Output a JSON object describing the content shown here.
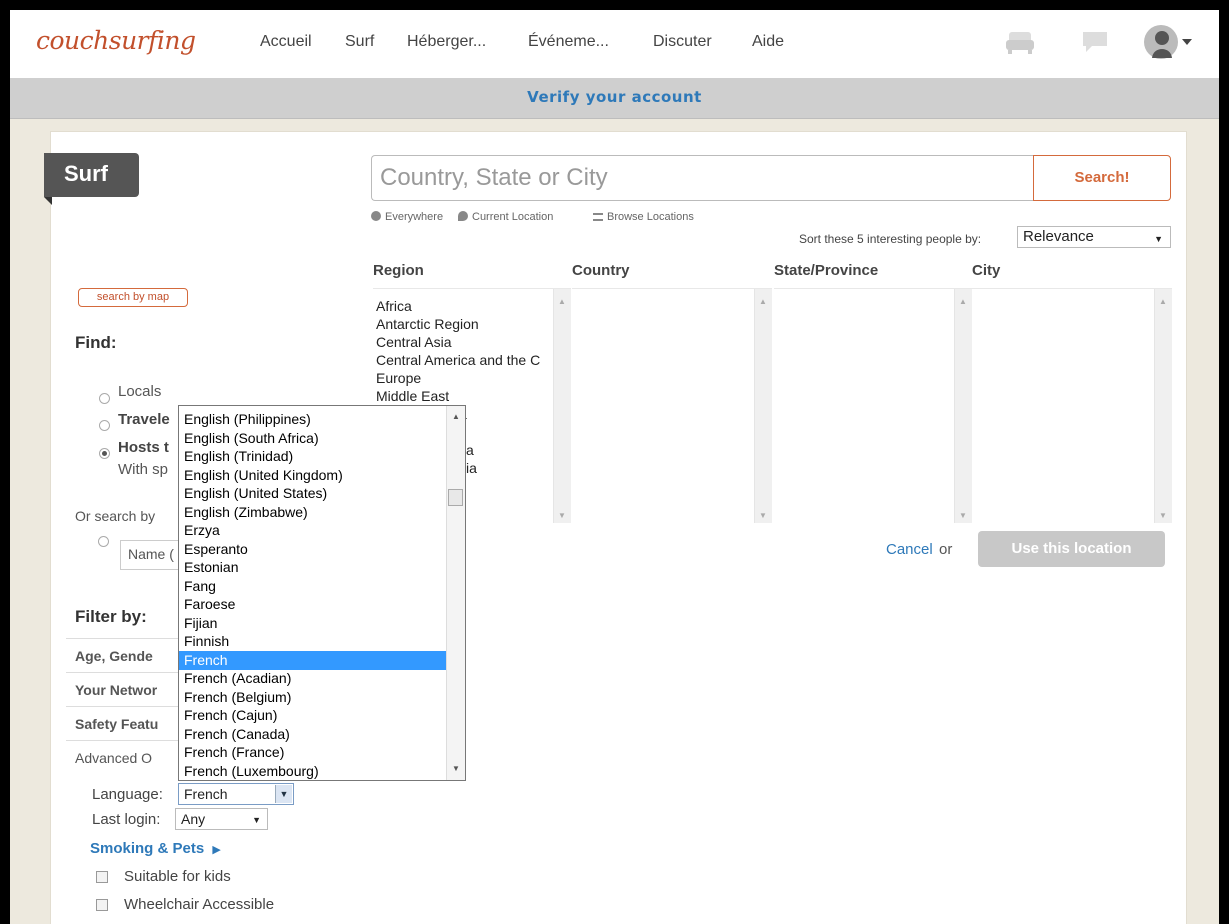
{
  "nav": {
    "logo": "couchsurfing",
    "items": [
      "Accueil",
      "Surf",
      "Héberger...",
      "Événeme...",
      "Discuter",
      "Aide"
    ]
  },
  "verify_bar": "Verify your account",
  "surf_tab": "Surf",
  "search": {
    "placeholder": "Country, State or City",
    "button": "Search!",
    "links": [
      "Everywhere",
      "Current Location",
      "Browse Locations"
    ]
  },
  "sort": {
    "label": "Sort these 5 interesting people by:",
    "value": "Relevance"
  },
  "columns": [
    "Region",
    "Country",
    "State/Province",
    "City"
  ],
  "regions": [
    "Africa",
    "Antarctic Region",
    "Central Asia",
    "Central America and the C",
    "Europe",
    "Middle East"
  ],
  "region_fragments": [
    "a",
    "ca",
    "sia"
  ],
  "actions": {
    "cancel": "Cancel",
    "or": "or",
    "use_location": "Use this location"
  },
  "left": {
    "map_button": "search by map",
    "find": "Find:",
    "options": [
      "Locals",
      "Travele",
      "Hosts t"
    ],
    "hosts_sub": "With sp",
    "or_search": "Or search by",
    "name_input": "Name (",
    "filter": "Filter by:",
    "filter_rows": [
      "Age, Gende",
      "Your Networ",
      "Safety Featu",
      "Advanced O"
    ],
    "language_label": "Language:",
    "language_value": "French",
    "login_label": "Last login:",
    "login_value": "Any",
    "smoking": "Smoking & Pets",
    "checkboxes": [
      "Suitable for kids",
      "Wheelchair Accessible"
    ]
  },
  "dropdown": {
    "items": [
      "English (Philippines)",
      "English (South Africa)",
      "English (Trinidad)",
      "English (United Kingdom)",
      "English (United States)",
      "English (Zimbabwe)",
      "Erzya",
      "Esperanto",
      "Estonian",
      "Fang",
      "Faroese",
      "Fijian",
      "Finnish",
      "French",
      "French (Acadian)",
      "French (Belgium)",
      "French (Cajun)",
      "French (Canada)",
      "French (France)",
      "French (Luxembourg)"
    ],
    "selected": "French"
  },
  "colors": {
    "brand": "#c2502c",
    "link": "#2e79b9",
    "selection": "#3399ff"
  },
  "icons": [
    "couch-icon",
    "chat-icon",
    "avatar",
    "chevron-down-icon",
    "globe-icon",
    "pin-icon",
    "list-icon",
    "play-icon"
  ]
}
